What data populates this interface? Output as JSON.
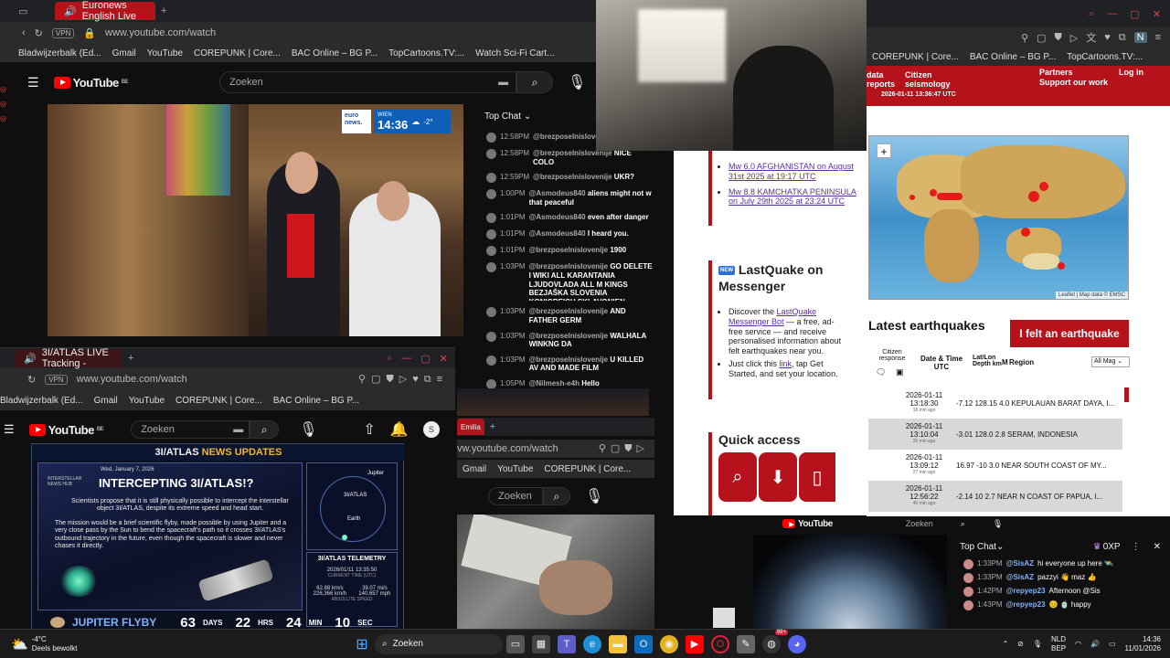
{
  "win1": {
    "tab_title": "Euronews English Live",
    "url": "www.youtube.com/watch",
    "vpn_label": "VPN",
    "bookmarks": [
      "Bladwijzerbalk (Ed...",
      "Gmail",
      "YouTube",
      "COREPUNK | Core...",
      "BAC Online – BG P...",
      "TopCartoons.TV:...",
      "Watch Sci-Fi Cart..."
    ],
    "yt_logo": "YouTube",
    "yt_country": "BE",
    "search_placeholder": "Zoeken",
    "overlay": {
      "brand_line1": "euro",
      "brand_line2": "news.",
      "city": "WIEN",
      "time": "14:36",
      "temp": "-2°"
    },
    "chat_header": "Top Chat",
    "chat": [
      {
        "time": "12:58PM",
        "user": "@brezposelnislove",
        "msg": "STUFF WW2"
      },
      {
        "time": "12:58PM",
        "user": "@brezposelnislovenije",
        "msg": "NICE COLO"
      },
      {
        "time": "12:59PM",
        "user": "@brezposelnislovenije",
        "msg": "UKR?"
      },
      {
        "time": "1:00PM",
        "user": "@Asmodeus840",
        "msg": "aliens might not w that peaceful"
      },
      {
        "time": "1:01PM",
        "user": "@Asmodeus840",
        "msg": "even after danger"
      },
      {
        "time": "1:01PM",
        "user": "@Asmodeus840",
        "msg": "I heard you."
      },
      {
        "time": "1:01PM",
        "user": "@brezposelnislovenije",
        "msg": "1900"
      },
      {
        "time": "1:03PM",
        "user": "@brezposelnislovenije",
        "msg": "GO DELETE I WIKI ALL KARANTANIA LJUDOVLADA ALL M KINGS BEZJAŠKA SLOVENIA KONIGREICH SKLAVONIEN ...... MAKE UP SOME AUSTROHUNGARY ...."
      },
      {
        "time": "1:03PM",
        "user": "@brezposelnislovenije",
        "msg": "AND FATHER GERM"
      },
      {
        "time": "1:03PM",
        "user": "@brezposelnislovenije",
        "msg": "WALHALA WINKNG DA"
      },
      {
        "time": "1:03PM",
        "user": "@brezposelnislovenije",
        "msg": "U KILLED AV AND MADE FILM"
      },
      {
        "time": "1:05PM",
        "user": "@Nilmesh-e4h",
        "msg": "Hello"
      }
    ]
  },
  "win2": {
    "tab_title": "3I/ATLAS LIVE Tracking -",
    "url": "www.youtube.com/watch",
    "vpn_label": "VPN",
    "bookmarks": [
      "Bladwijzerbalk (Ed...",
      "Gmail",
      "YouTube",
      "COREPUNK | Core...",
      "BAC Online – BG P..."
    ],
    "yt_logo": "YouTube",
    "yt_country": "BE",
    "search_placeholder": "Zoeken",
    "avatar_letter": "S",
    "banner": {
      "prefix": "3I/ATLAS",
      "title": "NEWS UPDATES"
    },
    "card": {
      "date": "Wed, January 7, 2026",
      "brand": "INTERSTELLAR NEWS HUB",
      "headline": "INTERCEPTING 3I/ATLAS!?",
      "para1": "Scientists propose that it is still physically possible to intercept the interstellar object 3I/ATLAS, despite its extreme speed and head start.",
      "para2": "The mission would be a brief scientific flyby, made possible by using Jupiter and a very close pass by the Sun to bend the spacecraft's path so it crosses 3I/ATLAS's outbound trajectory in the future, even though the spacecraft is slower and never chases it directly."
    },
    "orbit": {
      "jupiter": "Jupiter",
      "atlas": "3I/ATLAS",
      "earth": "Earth"
    },
    "telemetry": {
      "title": "3I/ATLAS TELEMETRY",
      "datetime": "2026/01/11 13:35:50",
      "datetime_label": "CURRENT TIME (UTC)",
      "v1": "62.88 km/s",
      "v2": "39.07 mi/s",
      "v3": "226,366 km/h",
      "v4": "140,657 mph",
      "speed_label": "ABSOLUTE SPEED"
    },
    "countdown": {
      "title": "JUPITER FLYBY",
      "days": "63",
      "days_label": "DAYS",
      "hrs": "22",
      "hrs_label": "HRS",
      "min": "24",
      "min_label": "MIN",
      "sec": "10",
      "sec_label": "SEC"
    }
  },
  "win3": {
    "tab_label": "Emilia",
    "url": "vw.youtube.com/watch",
    "bookmarks": [
      "Gmail",
      "YouTube",
      "COREPUNK | Core..."
    ],
    "search_placeholder": "Zoeken"
  },
  "emsc_left": {
    "links": [
      "Mw 6.0 AFGHANISTAN on August 31st 2025 at 19:17 UTC",
      "Mw 8.8 KAMCHATKA PENINSULA on July 29th 2025 at 23:24 UTC"
    ],
    "messenger_badge": "NEW",
    "messenger_title": "LastQuake on Messenger",
    "messenger_intro": "Discover the",
    "messenger_bot": "LastQuake Messenger Bot",
    "messenger_body": "— a free, ad-free service — and receive personalised information about felt earthquakes near you.",
    "messenger_click_pre": "Just click this",
    "messenger_click_link": "link",
    "messenger_click_post": ", tap Get Started, and set your location.",
    "quick_access": "Quick access"
  },
  "emsc_right": {
    "bookmarks": [
      "COREPUNK | Core...",
      "BAC Online – BG P...",
      "TopCartoons.TV:..."
    ],
    "nav_left": "data reports",
    "nav_center_1": "Citizen",
    "nav_center_2": "seismology",
    "nav_right_1": "Partners",
    "nav_right_2": "Support our work",
    "login": "Log in",
    "timestamp": "2026-01-11 13:36:47 UTC",
    "map_zoom": "+",
    "map_credit": "Leaflet | Map data © EMSC",
    "latest_title": "Latest earthquakes",
    "felt_button": "I felt an earthquake",
    "col_citizen": "Citizen response",
    "col_datetime": "Date & Time UTC",
    "col_latlon": "Lat/Lon Depth km",
    "col_m": "M",
    "col_region": "Region",
    "mag_select": "All Mag",
    "rows": [
      {
        "date": "2026-01-11",
        "time": "13:18:30",
        "ago": "18 min ago",
        "data": "-7.12 128.15 4.0 KEPULAUAN BARAT DAYA, I..."
      },
      {
        "date": "2026-01-11",
        "time": "13:10:04",
        "ago": "26 min ago",
        "data": "-3.01 128.0 2.8 SERAM, INDONESIA"
      },
      {
        "date": "2026-01-11",
        "time": "13:09:12",
        "ago": "27 min ago",
        "data": "16.97 -10 3.0 NEAR SOUTH COAST OF MY..."
      },
      {
        "date": "2026-01-11",
        "time": "12:56:22",
        "ago": "40 min ago",
        "data": "-2.14 10 2.7 NEAR N COAST OF PAPUA, I..."
      }
    ]
  },
  "win5": {
    "yt_logo": "YouTube",
    "search_placeholder": "Zoeken",
    "chat_header": "Top Chat",
    "points_label": "0XP",
    "chat": [
      {
        "time": "1:33PM",
        "user": "@SisAZ",
        "msg": "hi everyone up here 🛰️"
      },
      {
        "time": "1:33PM",
        "user": "@SisAZ",
        "msg": "pazzyi 👋 maz 👍"
      },
      {
        "time": "1:42PM",
        "user": "@repyep23",
        "msg": "Afternoon @Sis"
      },
      {
        "time": "1:43PM",
        "user": "@repyep23",
        "msg": "😊 🍵 happy"
      }
    ]
  },
  "taskbar": {
    "weather_temp": "-4°C",
    "weather_desc": "Deels bewolkt",
    "search": "Zoeken",
    "lang_1": "NLD",
    "lang_2": "BEP",
    "time": "14:36",
    "date": "11/01/2026",
    "badge": "99+"
  },
  "colors": {
    "accent_red": "#b3131b",
    "yt_red": "#ff0000",
    "emsc_red": "#b5121b",
    "link_purple": "#5a2ea6"
  }
}
